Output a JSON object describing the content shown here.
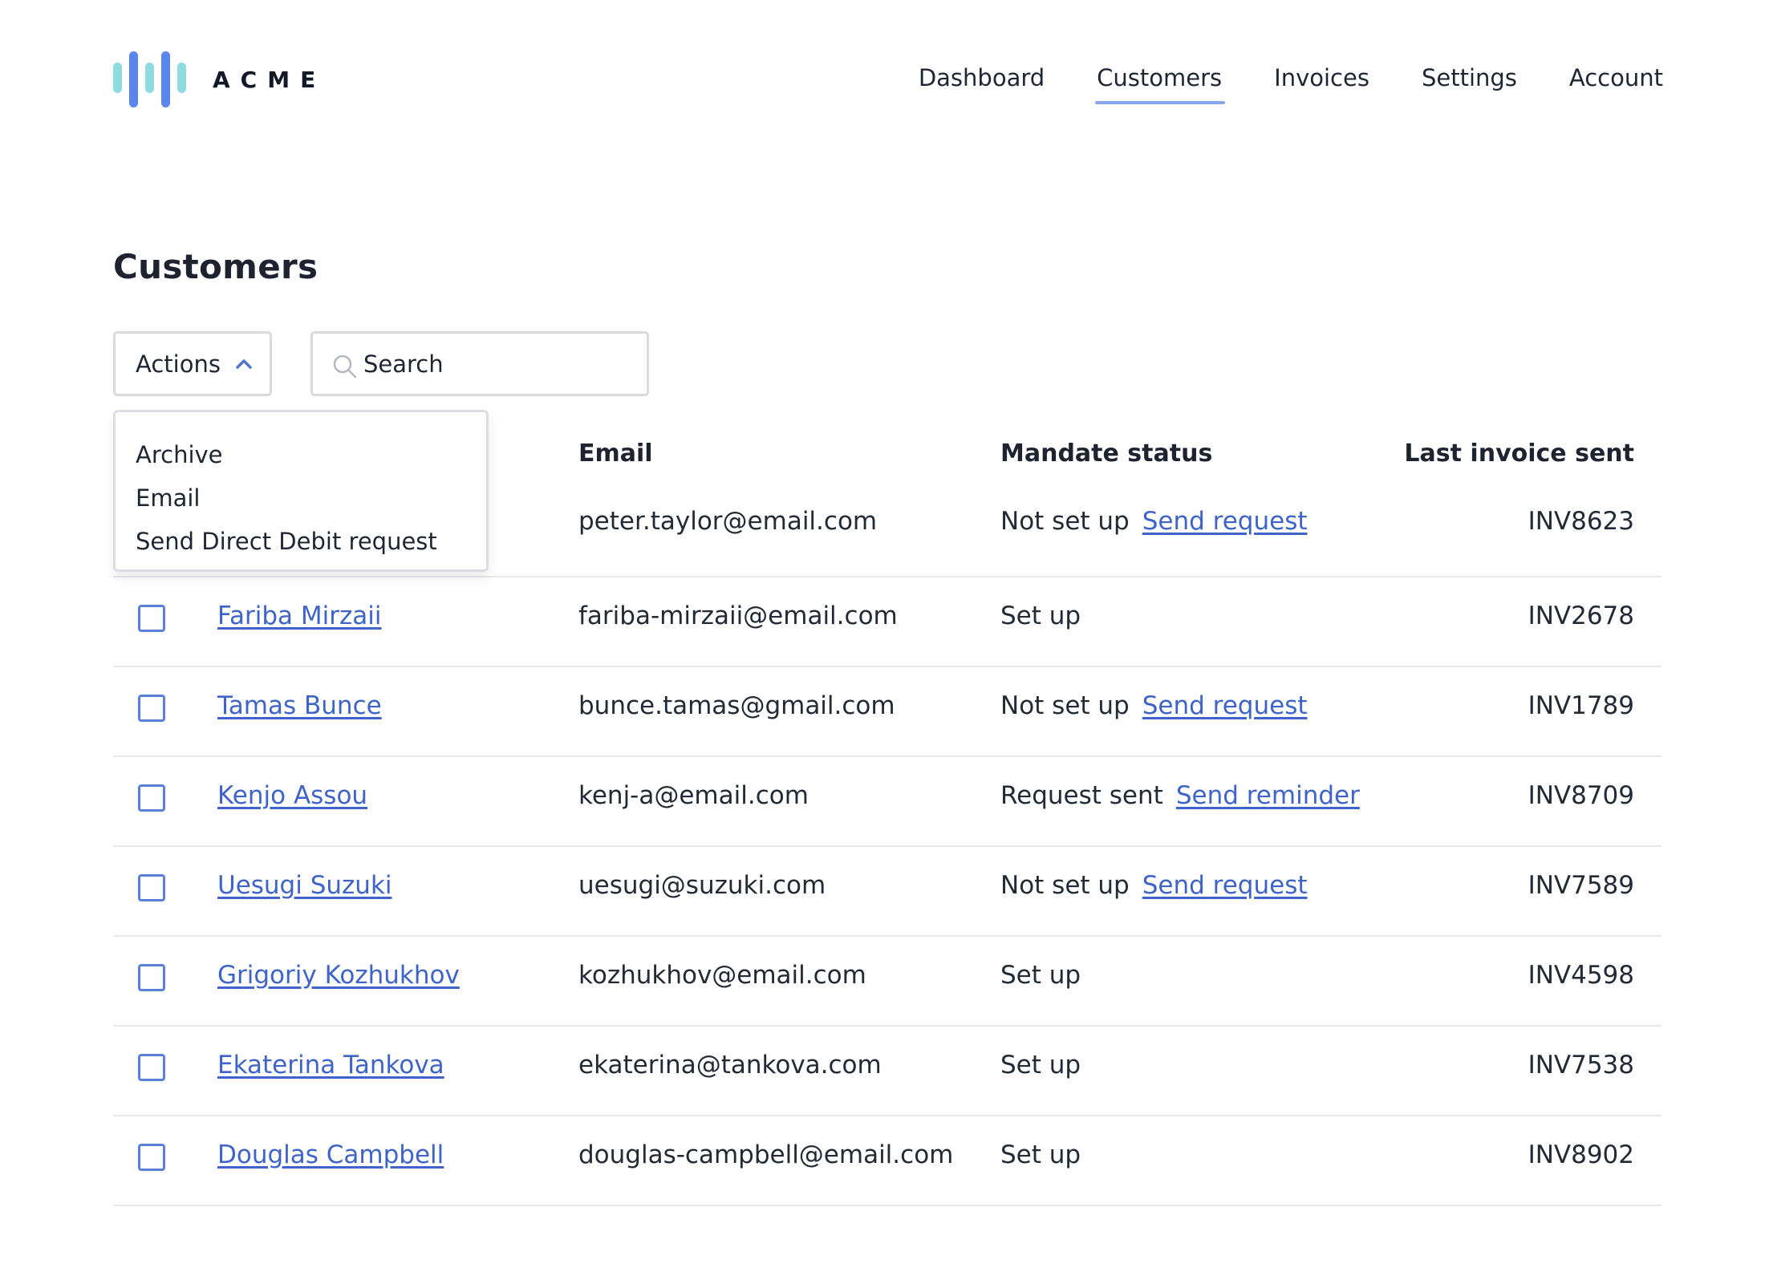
{
  "brand": {
    "name": "ACME",
    "colors": {
      "logo_light": "#8fdbe0",
      "logo_blue": "#5b86ec",
      "link": "#3e63c9",
      "nav_underline": "#86a6ea",
      "checkbox_border": "#5c7fd8"
    }
  },
  "nav": {
    "items": [
      {
        "label": "Dashboard",
        "active": false
      },
      {
        "label": "Customers",
        "active": true
      },
      {
        "label": "Invoices",
        "active": false
      },
      {
        "label": "Settings",
        "active": false
      },
      {
        "label": "Account",
        "active": false
      }
    ]
  },
  "page": {
    "title": "Customers"
  },
  "toolbar": {
    "actions_label": "Actions",
    "actions_icon": "chevron-up-icon",
    "search_placeholder": "Search",
    "search_value": "",
    "search_icon": "search-icon"
  },
  "actions_menu": {
    "items": [
      "Archive",
      "Email",
      "Send Direct Debit request"
    ]
  },
  "table": {
    "headers": {
      "email": "Email",
      "mandate": "Mandate status",
      "invoice": "Last invoice sent"
    },
    "rows": [
      {
        "name": "",
        "email": "peter.taylor@email.com",
        "status": "Not set up",
        "action": "Send request",
        "invoice": "INV8623"
      },
      {
        "name": "Fariba Mirzaii",
        "email": "fariba-mirzaii@email.com",
        "status": "Set up",
        "action": "",
        "invoice": "INV2678"
      },
      {
        "name": "Tamas Bunce",
        "email": "bunce.tamas@gmail.com",
        "status": "Not set up",
        "action": "Send request",
        "invoice": "INV1789"
      },
      {
        "name": "Kenjo Assou",
        "email": "kenj-a@email.com",
        "status": "Request sent",
        "action": "Send reminder",
        "invoice": "INV8709"
      },
      {
        "name": "Uesugi Suzuki",
        "email": "uesugi@suzuki.com",
        "status": "Not set up",
        "action": "Send request",
        "invoice": "INV7589"
      },
      {
        "name": "Grigoriy Kozhukhov",
        "email": "kozhukhov@email.com",
        "status": "Set up",
        "action": "",
        "invoice": "INV4598"
      },
      {
        "name": "Ekaterina Tankova",
        "email": "ekaterina@tankova.com",
        "status": "Set up",
        "action": "",
        "invoice": "INV7538"
      },
      {
        "name": "Douglas Campbell",
        "email": "douglas-campbell@email.com",
        "status": "Set up",
        "action": "",
        "invoice": "INV8902"
      }
    ]
  }
}
